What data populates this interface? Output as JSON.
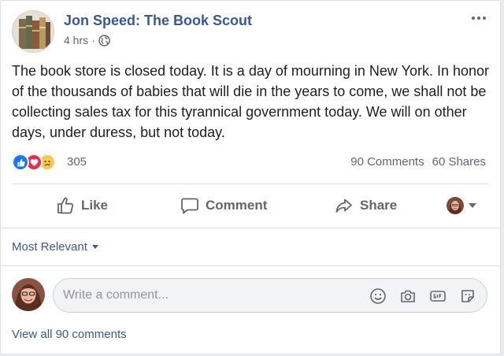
{
  "post": {
    "page_name": "Jon Speed: The Book Scout",
    "time": "4 hrs",
    "meta_separator": "·",
    "text": "The book store is closed today. It is a day of mourning in New York. In honor of the thousands of babies that will die in the years to come, we shall not be collecting sales tax for this tyrannical government today. We will on other days, under duress, but not today."
  },
  "stats": {
    "reactions": [
      "like-icon",
      "love-icon",
      "sad-icon"
    ],
    "reaction_count": "305",
    "comments": "90 Comments",
    "shares": "60 Shares"
  },
  "actions": {
    "like": "Like",
    "comment": "Comment",
    "share": "Share"
  },
  "comments": {
    "sort_label": "Most Relevant",
    "input_placeholder": "Write a comment...",
    "view_all": "View all 90 comments"
  },
  "colors": {
    "link": "#385898",
    "muted": "#606770",
    "like": "#1877f2",
    "love": "#f0284a",
    "sad": "#f7c94a"
  }
}
